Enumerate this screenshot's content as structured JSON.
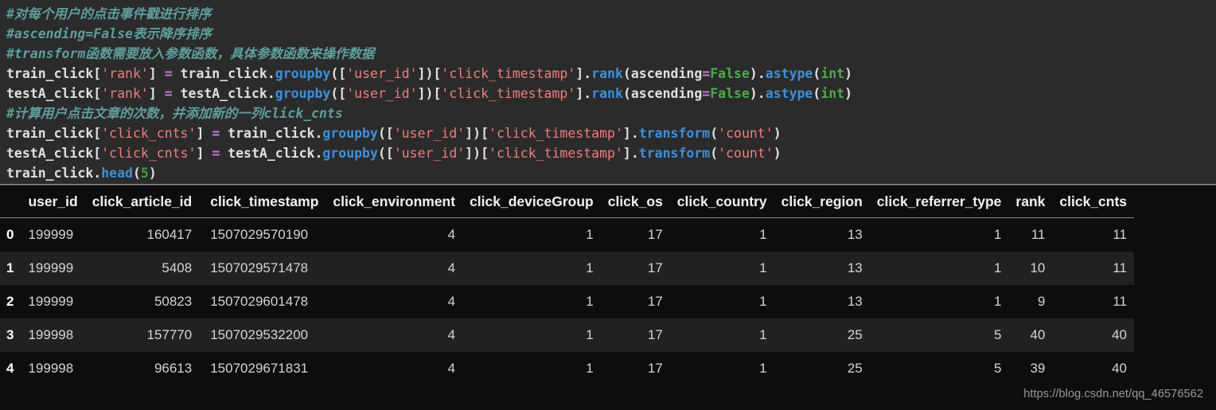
{
  "code": {
    "language": "python",
    "background_color": "#2b2b2b",
    "lines": [
      {
        "id": "line-1",
        "tokens": [
          {
            "t": "comment",
            "v": "#对每个用户的点击事件戳进行排序"
          }
        ]
      },
      {
        "id": "line-2",
        "tokens": [
          {
            "t": "comment",
            "v": "#ascending=False表示降序排序"
          }
        ]
      },
      {
        "id": "line-3",
        "tokens": [
          {
            "t": "comment",
            "v": "#transform函数需要放入参数函数，具体参数函数来操作数据"
          }
        ]
      },
      {
        "id": "line-4",
        "tokens": [
          {
            "t": "plain",
            "v": "train_click["
          },
          {
            "t": "str",
            "v": "'rank'"
          },
          {
            "t": "plain",
            "v": "] "
          },
          {
            "t": "op",
            "v": "="
          },
          {
            "t": "plain",
            "v": " train_click."
          },
          {
            "t": "fn",
            "v": "groupby"
          },
          {
            "t": "plain",
            "v": "(["
          },
          {
            "t": "str",
            "v": "'user_id'"
          },
          {
            "t": "plain",
            "v": "])["
          },
          {
            "t": "str",
            "v": "'click_timestamp'"
          },
          {
            "t": "plain",
            "v": "]."
          },
          {
            "t": "fn",
            "v": "rank"
          },
          {
            "t": "plain",
            "v": "(ascending"
          },
          {
            "t": "op",
            "v": "="
          },
          {
            "t": "kw",
            "v": "False"
          },
          {
            "t": "plain",
            "v": ")."
          },
          {
            "t": "fn",
            "v": "astype"
          },
          {
            "t": "plain",
            "v": "("
          },
          {
            "t": "kw",
            "v": "int"
          },
          {
            "t": "plain",
            "v": ")"
          }
        ]
      },
      {
        "id": "line-5",
        "tokens": [
          {
            "t": "plain",
            "v": "testA_click["
          },
          {
            "t": "str",
            "v": "'rank'"
          },
          {
            "t": "plain",
            "v": "] "
          },
          {
            "t": "op",
            "v": "="
          },
          {
            "t": "plain",
            "v": " testA_click."
          },
          {
            "t": "fn",
            "v": "groupby"
          },
          {
            "t": "plain",
            "v": "(["
          },
          {
            "t": "str",
            "v": "'user_id'"
          },
          {
            "t": "plain",
            "v": "])["
          },
          {
            "t": "str",
            "v": "'click_timestamp'"
          },
          {
            "t": "plain",
            "v": "]."
          },
          {
            "t": "fn",
            "v": "rank"
          },
          {
            "t": "plain",
            "v": "(ascending"
          },
          {
            "t": "op",
            "v": "="
          },
          {
            "t": "kw",
            "v": "False"
          },
          {
            "t": "plain",
            "v": ")."
          },
          {
            "t": "fn",
            "v": "astype"
          },
          {
            "t": "plain",
            "v": "("
          },
          {
            "t": "kw",
            "v": "int"
          },
          {
            "t": "plain",
            "v": ")"
          }
        ]
      },
      {
        "id": "line-6",
        "tokens": [
          {
            "t": "comment",
            "v": "#计算用户点击文章的次数，并添加新的一列click_cnts"
          }
        ]
      },
      {
        "id": "line-7",
        "tokens": [
          {
            "t": "plain",
            "v": "train_click["
          },
          {
            "t": "str",
            "v": "'click_cnts'"
          },
          {
            "t": "plain",
            "v": "] "
          },
          {
            "t": "op",
            "v": "="
          },
          {
            "t": "plain",
            "v": " train_click."
          },
          {
            "t": "fn",
            "v": "groupby"
          },
          {
            "t": "plain",
            "v": "(["
          },
          {
            "t": "str",
            "v": "'user_id'"
          },
          {
            "t": "plain",
            "v": "])["
          },
          {
            "t": "str",
            "v": "'click_timestamp'"
          },
          {
            "t": "plain",
            "v": "]."
          },
          {
            "t": "fn",
            "v": "transform"
          },
          {
            "t": "plain",
            "v": "("
          },
          {
            "t": "str",
            "v": "'count'"
          },
          {
            "t": "plain",
            "v": ")"
          }
        ]
      },
      {
        "id": "line-8",
        "tokens": [
          {
            "t": "plain",
            "v": "testA_click["
          },
          {
            "t": "str",
            "v": "'click_cnts'"
          },
          {
            "t": "plain",
            "v": "] "
          },
          {
            "t": "op",
            "v": "="
          },
          {
            "t": "plain",
            "v": " testA_click."
          },
          {
            "t": "fn",
            "v": "groupby"
          },
          {
            "t": "plain",
            "v": "(["
          },
          {
            "t": "str",
            "v": "'user_id'"
          },
          {
            "t": "plain",
            "v": "])["
          },
          {
            "t": "str",
            "v": "'click_timestamp'"
          },
          {
            "t": "plain",
            "v": "]."
          },
          {
            "t": "fn",
            "v": "transform"
          },
          {
            "t": "plain",
            "v": "("
          },
          {
            "t": "str",
            "v": "'count'"
          },
          {
            "t": "plain",
            "v": ")"
          }
        ]
      },
      {
        "id": "line-9",
        "tokens": [
          {
            "t": "plain",
            "v": "train_click."
          },
          {
            "t": "fn",
            "v": "head"
          },
          {
            "t": "plain",
            "v": "("
          },
          {
            "t": "num",
            "v": "5"
          },
          {
            "t": "plain",
            "v": ")"
          }
        ]
      }
    ]
  },
  "table": {
    "index_header": "",
    "columns": [
      "user_id",
      "click_article_id",
      "click_timestamp",
      "click_environment",
      "click_deviceGroup",
      "click_os",
      "click_country",
      "click_region",
      "click_referrer_type",
      "rank",
      "click_cnts"
    ],
    "rows": [
      {
        "index": "0",
        "striped": false,
        "cells": [
          "199999",
          "160417",
          "1507029570190",
          "4",
          "1",
          "17",
          "1",
          "13",
          "1",
          "11",
          "11"
        ]
      },
      {
        "index": "1",
        "striped": true,
        "cells": [
          "199999",
          "5408",
          "1507029571478",
          "4",
          "1",
          "17",
          "1",
          "13",
          "1",
          "10",
          "11"
        ]
      },
      {
        "index": "2",
        "striped": false,
        "cells": [
          "199999",
          "50823",
          "1507029601478",
          "4",
          "1",
          "17",
          "1",
          "13",
          "1",
          "9",
          "11"
        ]
      },
      {
        "index": "3",
        "striped": true,
        "cells": [
          "199998",
          "157770",
          "1507029532200",
          "4",
          "1",
          "17",
          "1",
          "25",
          "5",
          "40",
          "40"
        ]
      },
      {
        "index": "4",
        "striped": false,
        "cells": [
          "199998",
          "96613",
          "1507029671831",
          "4",
          "1",
          "17",
          "1",
          "25",
          "5",
          "39",
          "40"
        ]
      }
    ]
  },
  "watermark": {
    "text": "https://blog.csdn.net/qq_46576562"
  },
  "colors": {
    "code_background": "#2b2b2b",
    "table_background": "#0d0d0d",
    "stripe": "#212121",
    "comment": "#5f9e9d",
    "string": "#f07d7d",
    "operator": "#c678dd",
    "function": "#3e8fd8",
    "keyword": "#4bab4b",
    "text": "#e0e0e0"
  }
}
